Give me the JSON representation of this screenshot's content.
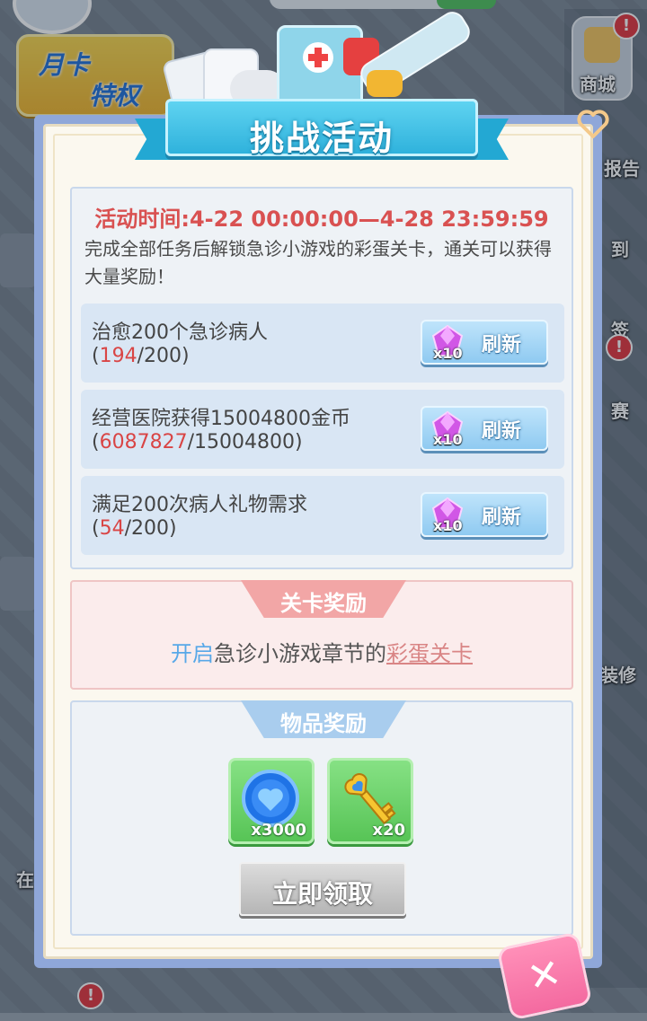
{
  "background": {
    "yueka_line1": "月卡",
    "yueka_line2": "特权",
    "shop_label": "商城",
    "side_labels": [
      "报告",
      "到",
      "签",
      "赛",
      "装修",
      "在"
    ],
    "badge_mark": "!"
  },
  "dialog": {
    "title": "挑战活动",
    "event_time": "活动时间:4-22 00:00:00—4-28 23:59:59",
    "description": "完成全部任务后解锁急诊小游戏的彩蛋关卡，通关可以获得大量奖励！",
    "tasks": [
      {
        "name": "治愈200个急诊病人",
        "open": "(",
        "current": "194",
        "rest": "/200)",
        "refresh_cost": "x10",
        "refresh_label": "刷新"
      },
      {
        "name": "经营医院获得15004800金币",
        "open": "(",
        "current": "6087827",
        "rest": "/15004800)",
        "refresh_cost": "x10",
        "refresh_label": "刷新"
      },
      {
        "name": "满足200次病人礼物需求",
        "open": "(",
        "current": "54",
        "rest": "/200)",
        "refresh_cost": "x10",
        "refresh_label": "刷新"
      }
    ],
    "stage_reward": {
      "header": "关卡奖励",
      "text_open": "开启",
      "text_middle": "急诊小游戏章节的",
      "text_egg": "彩蛋关卡"
    },
    "item_reward": {
      "header": "物品奖励",
      "items": [
        {
          "icon": "blue-heart-coin-icon",
          "count": "x3000"
        },
        {
          "icon": "golden-key-icon",
          "count": "x20"
        }
      ],
      "claim_label": "立即领取"
    },
    "close_label": "✕"
  },
  "colors": {
    "accent_blue": "#2fb2dc",
    "progress_red": "#d94545",
    "stage_pink_header": "#f2a6a6",
    "item_blue_header": "#a9cdee"
  }
}
